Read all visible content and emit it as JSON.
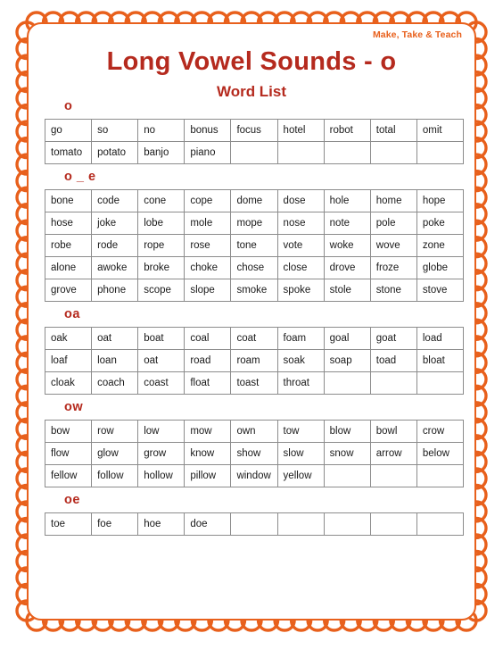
{
  "brand": "Make, Take & Teach",
  "title": "Long Vowel Sounds -  o",
  "subtitle": "Word List",
  "colors": {
    "title_red": "#B52A1E",
    "border_orange": "#E8601C",
    "table_border": "#8c8c8c",
    "cell_text": "#1a1a1a"
  },
  "columns": 9,
  "sections": [
    {
      "label": "o",
      "rows": [
        [
          "go",
          "so",
          "no",
          "bonus",
          "focus",
          "hotel",
          "robot",
          "total",
          "omit"
        ],
        [
          "tomato",
          "potato",
          "banjo",
          "piano",
          "",
          "",
          "",
          "",
          ""
        ]
      ]
    },
    {
      "label": "o _ e",
      "rows": [
        [
          "bone",
          "code",
          "cone",
          "cope",
          "dome",
          "dose",
          "hole",
          "home",
          "hope"
        ],
        [
          "hose",
          "joke",
          "lobe",
          "mole",
          "mope",
          "nose",
          "note",
          "pole",
          "poke"
        ],
        [
          "robe",
          "rode",
          "rope",
          "rose",
          "tone",
          "vote",
          "woke",
          "wove",
          "zone"
        ],
        [
          "alone",
          "awoke",
          "broke",
          "choke",
          "chose",
          "close",
          "drove",
          "froze",
          "globe"
        ],
        [
          "grove",
          "phone",
          "scope",
          "slope",
          "smoke",
          "spoke",
          "stole",
          "stone",
          "stove"
        ]
      ]
    },
    {
      "label": "oa",
      "rows": [
        [
          "oak",
          "oat",
          "boat",
          "coal",
          "coat",
          "foam",
          "goal",
          "goat",
          "load"
        ],
        [
          "loaf",
          "loan",
          "oat",
          "road",
          "roam",
          "soak",
          "soap",
          "toad",
          "bloat"
        ],
        [
          "cloak",
          "coach",
          "coast",
          "float",
          "toast",
          "throat",
          "",
          "",
          ""
        ]
      ]
    },
    {
      "label": "ow",
      "rows": [
        [
          "bow",
          "row",
          "low",
          "mow",
          "own",
          "tow",
          "blow",
          "bowl",
          "crow"
        ],
        [
          "flow",
          "glow",
          "grow",
          "know",
          "show",
          "slow",
          "snow",
          "arrow",
          "below"
        ],
        [
          "fellow",
          "follow",
          "hollow",
          "pillow",
          "window",
          "yellow",
          "",
          "",
          ""
        ]
      ]
    },
    {
      "label": "oe",
      "rows": [
        [
          "toe",
          "foe",
          "hoe",
          "doe",
          "",
          "",
          "",
          "",
          ""
        ]
      ]
    }
  ]
}
